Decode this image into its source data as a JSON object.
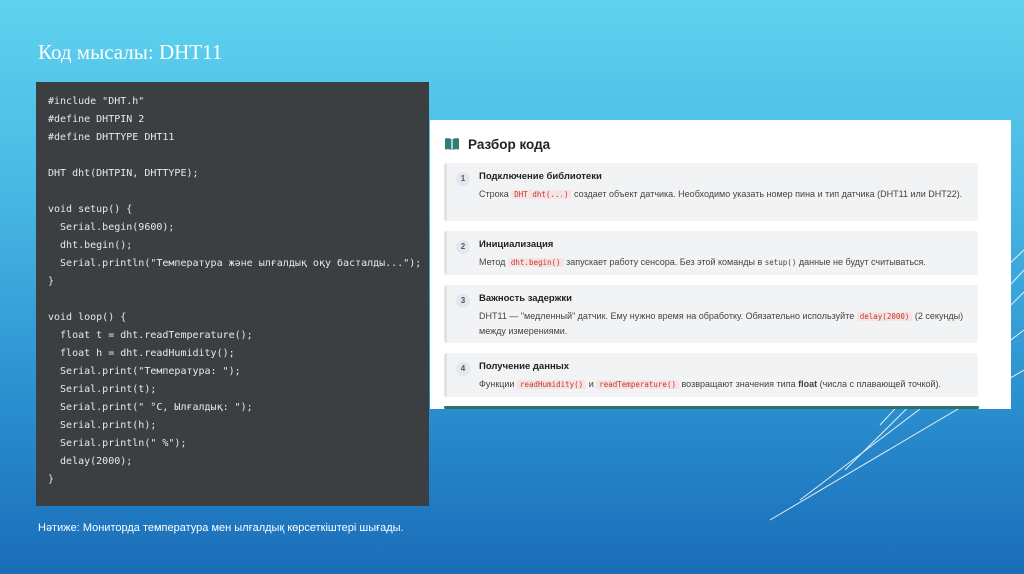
{
  "title": "Код мысалы: DHT11",
  "code": {
    "lines": [
      "#include \"DHT.h\"",
      "#define DHTPIN 2",
      "#define DHTTYPE DHT11",
      "",
      "DHT dht(DHTPIN, DHTTYPE);",
      "",
      "void setup() {",
      "  Serial.begin(9600);",
      "  dht.begin();",
      "  Serial.println(\"Температура және ылғалдық оқу басталды...\");",
      "}",
      "",
      "void loop() {",
      "  float t = dht.readTemperature();",
      "  float h = dht.readHumidity();",
      "  Serial.print(\"Температура: \");",
      "  Serial.print(t);",
      "  Serial.print(\" °C, Ылғалдық: \");",
      "  Serial.print(h);",
      "  Serial.println(\" %\");",
      "  delay(2000);",
      "}"
    ]
  },
  "review": {
    "icon": "book-icon",
    "title": "Разбор кода",
    "steps": [
      {
        "num": "1",
        "title": "Подключение библиотеки",
        "t1": "Строка ",
        "c1": "DHT dht(...)",
        "t2": " создает объект датчика. Необходимо указать номер пина и тип датчика (DHT11 или DHT22)."
      },
      {
        "num": "2",
        "title": "Инициализация",
        "t1": "Метод ",
        "c1": "dht.begin()",
        "t2": " запускает работу сенсора. Без этой команды в ",
        "c2": "setup()",
        "t3": " данные не будут считываться."
      },
      {
        "num": "3",
        "title": "Важность задержки",
        "t1": "DHT11 — \"медленный\" датчик. Ему нужно время на обработку. Обязательно используйте ",
        "c1": "delay(2000)",
        "t2": " (2 секунды) между измерениями."
      },
      {
        "num": "4",
        "title": "Получение данных",
        "t1": "Функции ",
        "c1": "readHumidity()",
        "t2": " и ",
        "c2": "readTemperature()",
        "t3": " возвращают значения типа ",
        "b1": "float",
        "t4": " (числа с плавающей точкой)."
      }
    ]
  },
  "footer": "Нәтиже: Мониторда температура мен ылғалдық көрсеткіштері шығады."
}
